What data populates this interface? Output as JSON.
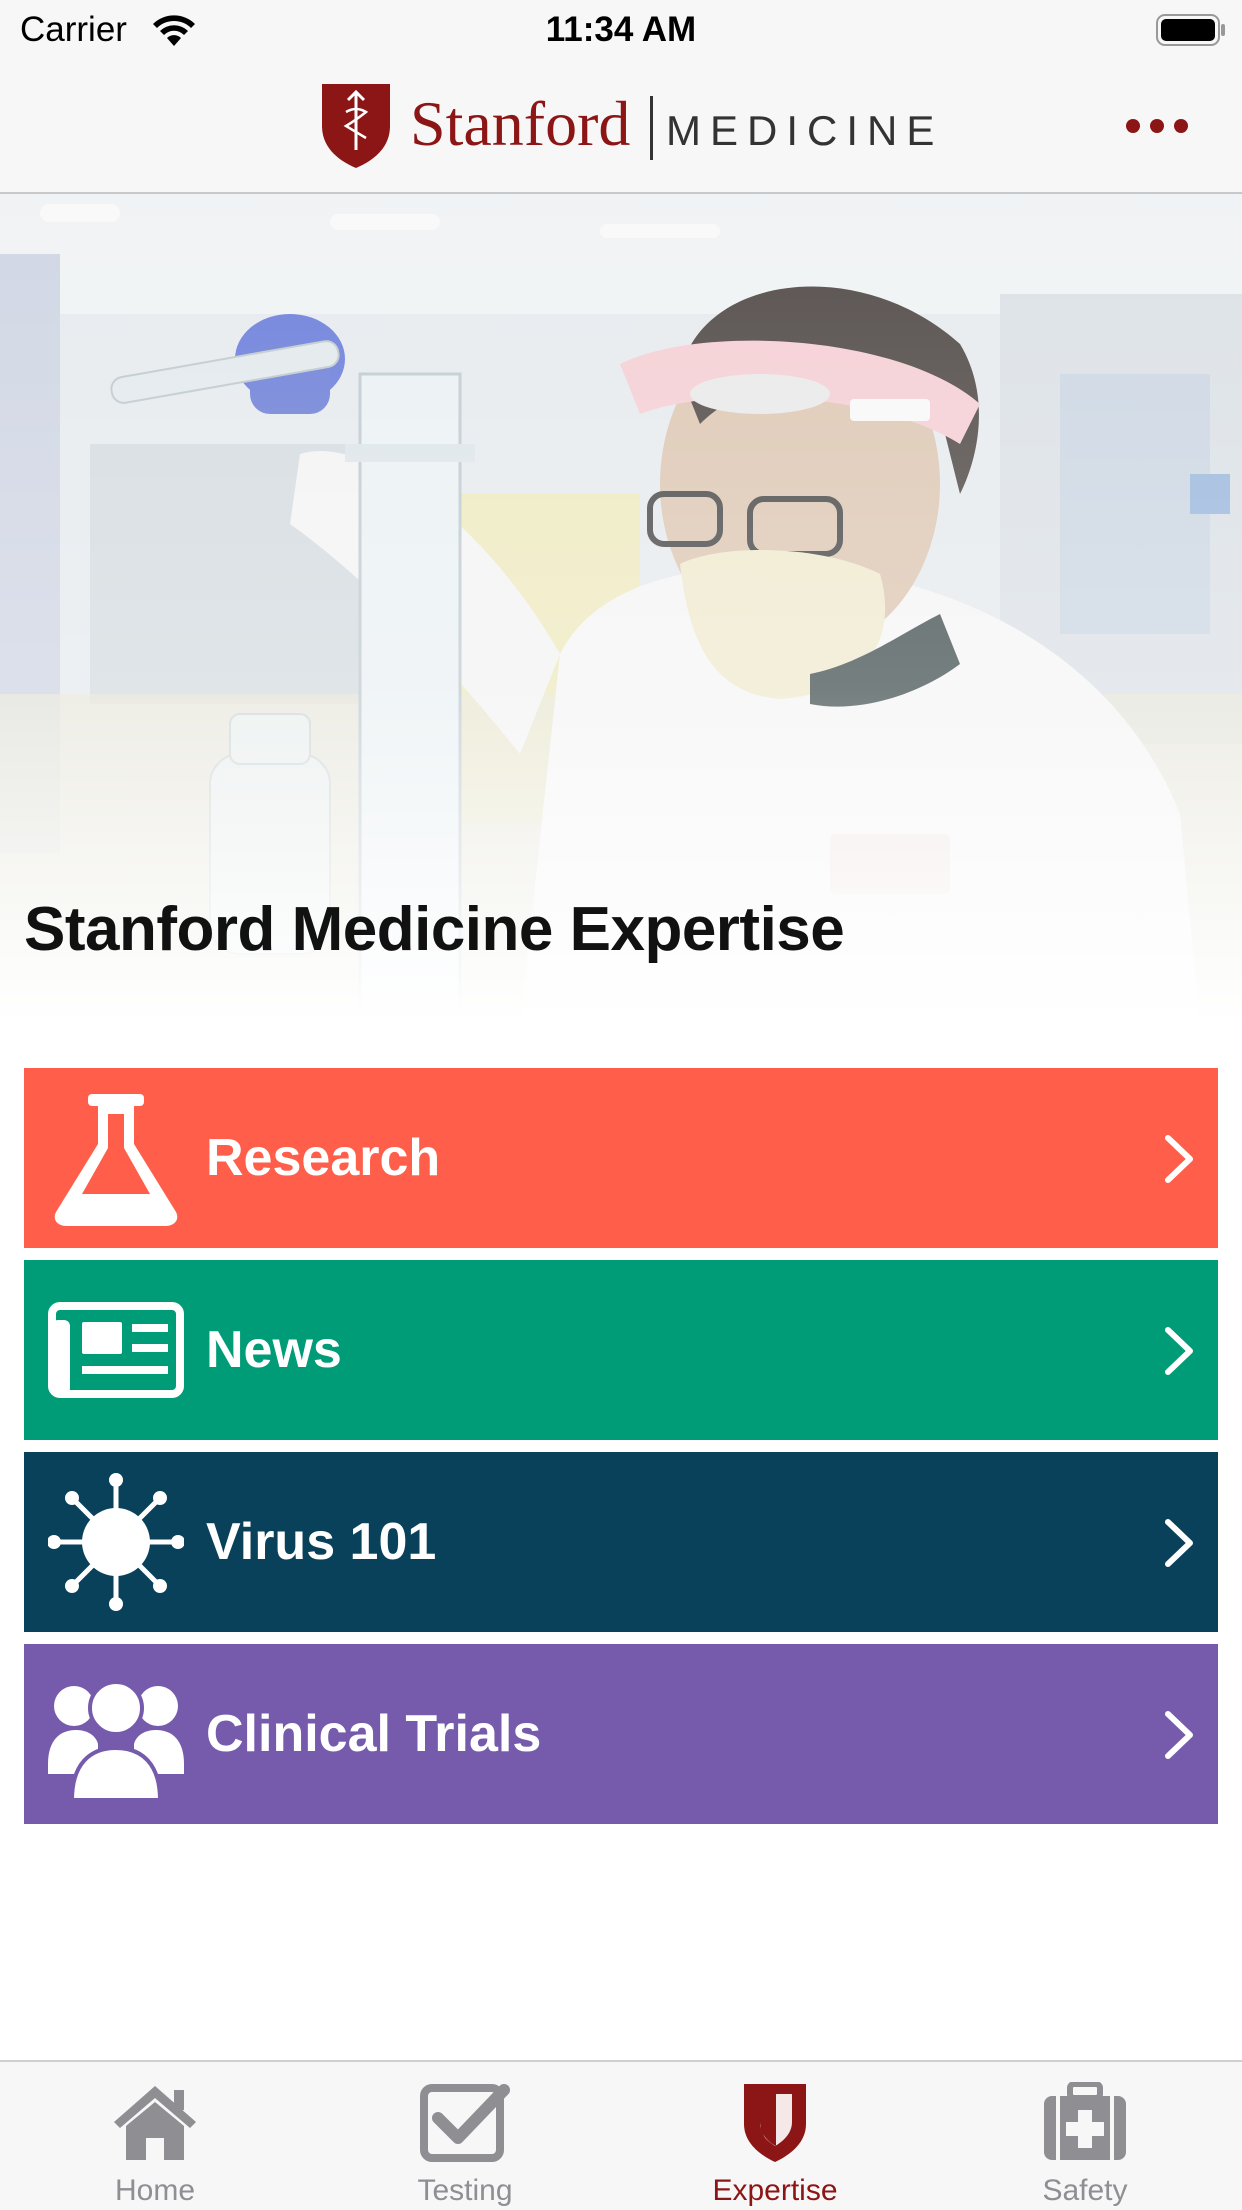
{
  "status_bar": {
    "carrier": "Carrier",
    "time": "11:34 AM"
  },
  "header": {
    "logo_word": "Stanford",
    "logo_sub": "MEDICINE",
    "brand_color": "#8c1515",
    "more_icon": "more-icon"
  },
  "hero": {
    "title": "Stanford Medicine Expertise"
  },
  "menu": {
    "items": [
      {
        "label": "Research",
        "icon": "flask-icon",
        "color": "#ff5f4a"
      },
      {
        "label": "News",
        "icon": "newspaper-icon",
        "color": "#009b77"
      },
      {
        "label": "Virus 101",
        "icon": "virus-icon",
        "color": "#09405a"
      },
      {
        "label": "Clinical Trials",
        "icon": "users-icon",
        "color": "#765bad"
      }
    ]
  },
  "tab_bar": {
    "tabs": [
      {
        "label": "Home",
        "icon": "home-icon",
        "active": false
      },
      {
        "label": "Testing",
        "icon": "checkbox-icon",
        "active": false
      },
      {
        "label": "Expertise",
        "icon": "shield-icon",
        "active": true
      },
      {
        "label": "Safety",
        "icon": "first-aid-kit-icon",
        "active": false
      }
    ],
    "active_color": "#8c1515",
    "inactive_color": "#8e8e93"
  }
}
